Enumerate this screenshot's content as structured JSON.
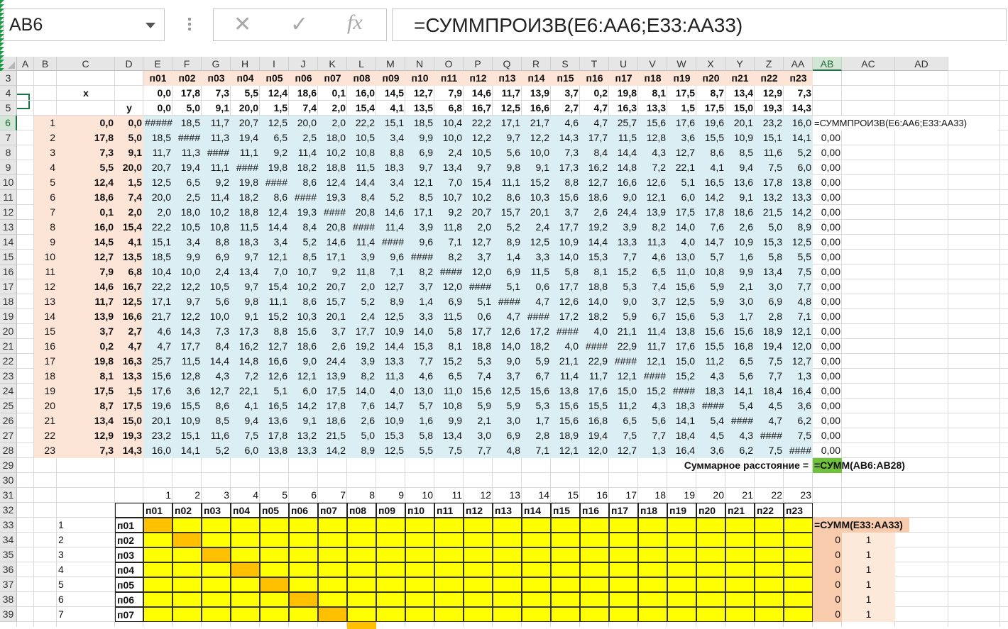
{
  "namebox": {
    "value": "AB6"
  },
  "formula_bar": {
    "formula": "=СУММПРОИЗВ(E6:AA6;E33:AA33)"
  },
  "toolbar_icons": [
    "cancel-icon",
    "confirm-icon",
    "function-icon"
  ],
  "columns": [
    "A",
    "B",
    "C",
    "D",
    "E",
    "F",
    "G",
    "H",
    "I",
    "J",
    "K",
    "L",
    "M",
    "N",
    "O",
    "P",
    "Q",
    "R",
    "S",
    "T",
    "U",
    "V",
    "W",
    "X",
    "Y",
    "Z",
    "AA",
    "AB",
    "AC",
    "AD"
  ],
  "selected_column": "AB",
  "selected_row": 6,
  "rows": [
    3,
    4,
    5,
    6,
    7,
    8,
    9,
    10,
    11,
    12,
    13,
    14,
    15,
    16,
    17,
    18,
    19,
    20,
    21,
    22,
    23,
    24,
    25,
    26,
    27,
    28,
    29,
    30,
    31,
    32,
    33,
    34,
    35,
    36,
    37,
    38,
    39
  ],
  "point_names": [
    "п01",
    "п02",
    "п03",
    "п04",
    "п05",
    "п06",
    "п07",
    "п08",
    "п09",
    "п10",
    "п11",
    "п12",
    "п13",
    "п14",
    "п15",
    "п16",
    "п17",
    "п18",
    "п19",
    "п20",
    "п21",
    "п22",
    "п23"
  ],
  "labels": {
    "x": "x",
    "y": "y",
    "total_label": "Суммарное расстояние =",
    "total_formula": "=СУММ(AB6:AB28)",
    "col_sum_formula": "=СУММ(E33:AA33)",
    "ab6_formula": "=СУММПРОИЗВ(E6:AA6;E33:AA33)"
  },
  "x_values": [
    "0,0",
    "17,8",
    "7,3",
    "5,5",
    "12,4",
    "18,6",
    "0,1",
    "16,0",
    "14,5",
    "12,7",
    "7,9",
    "14,6",
    "11,7",
    "13,9",
    "3,7",
    "0,2",
    "19,8",
    "8,1",
    "17,5",
    "8,7",
    "13,4",
    "12,9",
    "7,3"
  ],
  "y_values": [
    "0,0",
    "5,0",
    "9,1",
    "20,0",
    "1,5",
    "7,4",
    "2,0",
    "15,4",
    "4,1",
    "13,5",
    "6,8",
    "16,7",
    "12,5",
    "16,6",
    "2,7",
    "4,7",
    "16,3",
    "13,3",
    "1,5",
    "17,5",
    "15,0",
    "19,3",
    "14,3"
  ],
  "distance_matrix": [
    [
      "#####",
      "18,5",
      "11,7",
      "20,7",
      "12,5",
      "20,0",
      "2,0",
      "22,2",
      "15,1",
      "18,5",
      "10,4",
      "22,2",
      "17,1",
      "21,7",
      "4,6",
      "4,7",
      "25,7",
      "15,6",
      "17,6",
      "19,6",
      "20,1",
      "23,2",
      "16,0"
    ],
    [
      "18,5",
      "####",
      "11,3",
      "19,4",
      "6,5",
      "2,5",
      "18,0",
      "10,5",
      "3,4",
      "9,9",
      "10,0",
      "12,2",
      "9,7",
      "12,2",
      "14,3",
      "17,7",
      "11,5",
      "12,8",
      "3,6",
      "15,5",
      "10,9",
      "15,1",
      "14,1"
    ],
    [
      "11,7",
      "11,3",
      "####",
      "11,1",
      "9,2",
      "11,4",
      "10,2",
      "10,8",
      "8,8",
      "6,9",
      "2,4",
      "10,5",
      "5,6",
      "10,0",
      "7,3",
      "8,4",
      "14,4",
      "4,3",
      "12,7",
      "8,6",
      "8,5",
      "11,6",
      "5,2"
    ],
    [
      "20,7",
      "19,4",
      "11,1",
      "####",
      "19,8",
      "18,2",
      "18,8",
      "11,5",
      "18,3",
      "9,7",
      "13,4",
      "9,7",
      "9,8",
      "9,1",
      "17,3",
      "16,2",
      "14,8",
      "7,2",
      "22,1",
      "4,1",
      "9,4",
      "7,5",
      "6,0"
    ],
    [
      "12,5",
      "6,5",
      "9,2",
      "19,8",
      "####",
      "8,6",
      "12,4",
      "14,4",
      "3,4",
      "12,1",
      "7,0",
      "15,4",
      "11,1",
      "15,2",
      "8,8",
      "12,7",
      "16,6",
      "12,6",
      "5,1",
      "16,5",
      "13,6",
      "17,8",
      "13,8"
    ],
    [
      "20,0",
      "2,5",
      "11,4",
      "18,2",
      "8,6",
      "####",
      "19,3",
      "8,4",
      "5,2",
      "8,5",
      "10,7",
      "10,2",
      "8,6",
      "10,3",
      "15,6",
      "18,6",
      "9,0",
      "12,1",
      "6,0",
      "14,2",
      "9,1",
      "13,2",
      "13,3"
    ],
    [
      "2,0",
      "18,0",
      "10,2",
      "18,8",
      "12,4",
      "19,3",
      "####",
      "20,8",
      "14,6",
      "17,1",
      "9,2",
      "20,7",
      "15,7",
      "20,1",
      "3,7",
      "2,6",
      "24,4",
      "13,9",
      "17,5",
      "17,8",
      "18,6",
      "21,5",
      "14,2"
    ],
    [
      "22,2",
      "10,5",
      "10,8",
      "11,5",
      "14,4",
      "8,4",
      "20,8",
      "####",
      "11,4",
      "3,9",
      "11,8",
      "2,0",
      "5,2",
      "2,4",
      "17,7",
      "19,2",
      "3,9",
      "8,2",
      "14,0",
      "7,6",
      "2,6",
      "5,0",
      "8,9"
    ],
    [
      "15,1",
      "3,4",
      "8,8",
      "18,3",
      "3,4",
      "5,2",
      "14,6",
      "11,4",
      "####",
      "9,6",
      "7,1",
      "12,7",
      "8,9",
      "12,5",
      "10,9",
      "14,4",
      "13,3",
      "11,3",
      "4,0",
      "14,7",
      "10,9",
      "15,3",
      "12,5"
    ],
    [
      "18,5",
      "9,9",
      "6,9",
      "9,7",
      "12,1",
      "8,5",
      "17,1",
      "3,9",
      "9,6",
      "####",
      "8,2",
      "3,7",
      "1,4",
      "3,3",
      "14,0",
      "15,3",
      "7,7",
      "4,6",
      "13,0",
      "5,7",
      "1,6",
      "5,8",
      "5,5"
    ],
    [
      "10,4",
      "10,0",
      "2,4",
      "13,4",
      "7,0",
      "10,7",
      "9,2",
      "11,8",
      "7,1",
      "8,2",
      "####",
      "12,0",
      "6,9",
      "11,5",
      "5,8",
      "8,1",
      "15,2",
      "6,5",
      "11,0",
      "10,8",
      "9,9",
      "13,4",
      "7,5"
    ],
    [
      "22,2",
      "12,2",
      "10,5",
      "9,7",
      "15,4",
      "10,2",
      "20,7",
      "2,0",
      "12,7",
      "3,7",
      "12,0",
      "####",
      "5,1",
      "0,6",
      "17,7",
      "18,8",
      "5,3",
      "7,4",
      "15,6",
      "5,9",
      "2,1",
      "3,0",
      "7,7"
    ],
    [
      "17,1",
      "9,7",
      "5,6",
      "9,8",
      "11,1",
      "8,6",
      "15,7",
      "5,2",
      "8,9",
      "1,4",
      "6,9",
      "5,1",
      "####",
      "4,7",
      "12,6",
      "14,0",
      "9,0",
      "3,7",
      "12,5",
      "5,9",
      "3,0",
      "6,9",
      "4,8"
    ],
    [
      "21,7",
      "12,2",
      "10,0",
      "9,1",
      "15,2",
      "10,3",
      "20,1",
      "2,4",
      "12,5",
      "3,3",
      "11,5",
      "0,6",
      "4,7",
      "####",
      "17,2",
      "18,2",
      "5,9",
      "6,7",
      "15,6",
      "5,3",
      "1,7",
      "2,8",
      "7,1"
    ],
    [
      "4,6",
      "14,3",
      "7,3",
      "17,3",
      "8,8",
      "15,6",
      "3,7",
      "17,7",
      "10,9",
      "14,0",
      "5,8",
      "17,7",
      "12,6",
      "17,2",
      "####",
      "4,0",
      "21,1",
      "11,4",
      "13,8",
      "15,6",
      "15,6",
      "18,9",
      "12,1"
    ],
    [
      "4,7",
      "17,7",
      "8,4",
      "16,2",
      "12,7",
      "18,6",
      "2,6",
      "19,2",
      "14,4",
      "15,3",
      "8,1",
      "18,8",
      "14,0",
      "18,2",
      "4,0",
      "####",
      "22,9",
      "11,7",
      "17,6",
      "15,5",
      "16,8",
      "19,4",
      "12,0"
    ],
    [
      "25,7",
      "11,5",
      "14,4",
      "14,8",
      "16,6",
      "9,0",
      "24,4",
      "3,9",
      "13,3",
      "7,7",
      "15,2",
      "5,3",
      "9,0",
      "5,9",
      "21,1",
      "22,9",
      "####",
      "12,1",
      "15,0",
      "11,2",
      "6,5",
      "7,5",
      "12,7"
    ],
    [
      "15,6",
      "12,8",
      "4,3",
      "7,2",
      "12,6",
      "12,1",
      "13,9",
      "8,2",
      "11,3",
      "4,6",
      "6,5",
      "7,4",
      "3,7",
      "6,7",
      "11,4",
      "11,7",
      "12,1",
      "####",
      "15,2",
      "4,3",
      "5,6",
      "7,7",
      "1,3"
    ],
    [
      "17,6",
      "3,6",
      "12,7",
      "22,1",
      "5,1",
      "6,0",
      "17,5",
      "14,0",
      "4,0",
      "13,0",
      "11,0",
      "15,6",
      "12,5",
      "15,6",
      "13,8",
      "17,6",
      "15,0",
      "15,2",
      "####",
      "18,3",
      "14,1",
      "18,4",
      "16,4"
    ],
    [
      "19,6",
      "15,5",
      "8,6",
      "4,1",
      "16,5",
      "14,2",
      "17,8",
      "7,6",
      "14,7",
      "5,7",
      "10,8",
      "5,9",
      "5,9",
      "5,3",
      "15,6",
      "15,5",
      "11,2",
      "4,3",
      "18,3",
      "####",
      "5,4",
      "4,5",
      "3,6"
    ],
    [
      "20,1",
      "10,9",
      "8,5",
      "9,4",
      "13,6",
      "9,1",
      "18,6",
      "2,6",
      "10,9",
      "1,6",
      "9,9",
      "2,1",
      "3,0",
      "1,7",
      "15,6",
      "16,8",
      "6,5",
      "5,6",
      "14,1",
      "5,4",
      "####",
      "4,7",
      "6,2"
    ],
    [
      "23,2",
      "15,1",
      "11,6",
      "7,5",
      "17,8",
      "13,2",
      "21,5",
      "5,0",
      "15,3",
      "5,8",
      "13,4",
      "3,0",
      "6,9",
      "2,8",
      "18,9",
      "19,4",
      "7,5",
      "7,7",
      "18,4",
      "4,5",
      "4,3",
      "####",
      "7,5"
    ],
    [
      "16,0",
      "14,1",
      "5,2",
      "6,0",
      "13,8",
      "13,3",
      "14,2",
      "8,9",
      "12,5",
      "5,5",
      "7,5",
      "7,7",
      "4,8",
      "7,1",
      "12,1",
      "12,0",
      "12,7",
      "1,3",
      "16,4",
      "3,6",
      "6,2",
      "7,5",
      "####"
    ]
  ],
  "ab_values": [
    "0,00",
    "0,00",
    "0,00",
    "0,00",
    "0,00",
    "0,00",
    "0,00",
    "0,00",
    "0,00",
    "0,00",
    "0,00",
    "0,00",
    "0,00",
    "0,00",
    "0,00",
    "0,00",
    "0,00",
    "0,00",
    "0,00",
    "0,00",
    "0,00",
    "0,00"
  ],
  "row_numbers": [
    "1",
    "2",
    "3",
    "4",
    "5",
    "6",
    "7",
    "8",
    "9",
    "10",
    "11",
    "12",
    "13",
    "14",
    "15",
    "16",
    "17",
    "18",
    "19",
    "20",
    "21",
    "22",
    "23"
  ],
  "assign_index_row": [
    "1",
    "2",
    "3",
    "4",
    "5",
    "6",
    "7",
    "8",
    "9",
    "10",
    "11",
    "12",
    "13",
    "14",
    "15",
    "16",
    "17",
    "18",
    "19",
    "20",
    "21",
    "22",
    "23"
  ],
  "assign_row_numbers": [
    "1",
    "2",
    "3",
    "4",
    "5",
    "6",
    "7"
  ],
  "assign_row_names": [
    "п01",
    "п02",
    "п03",
    "п04",
    "п05",
    "п06",
    "п07"
  ],
  "assign_ab_values": [
    "0",
    "0",
    "0",
    "0",
    "0",
    "0"
  ],
  "assign_ac_values": [
    "1",
    "1",
    "1",
    "1",
    "1",
    "1"
  ],
  "colors": {
    "peach": "#fce4d6",
    "lightblue": "#daeef3",
    "yellow": "#ffff00",
    "orange": "#ffc000",
    "green": "#70c13c",
    "salmon": "#f8cbad",
    "select": "#1e7145"
  }
}
